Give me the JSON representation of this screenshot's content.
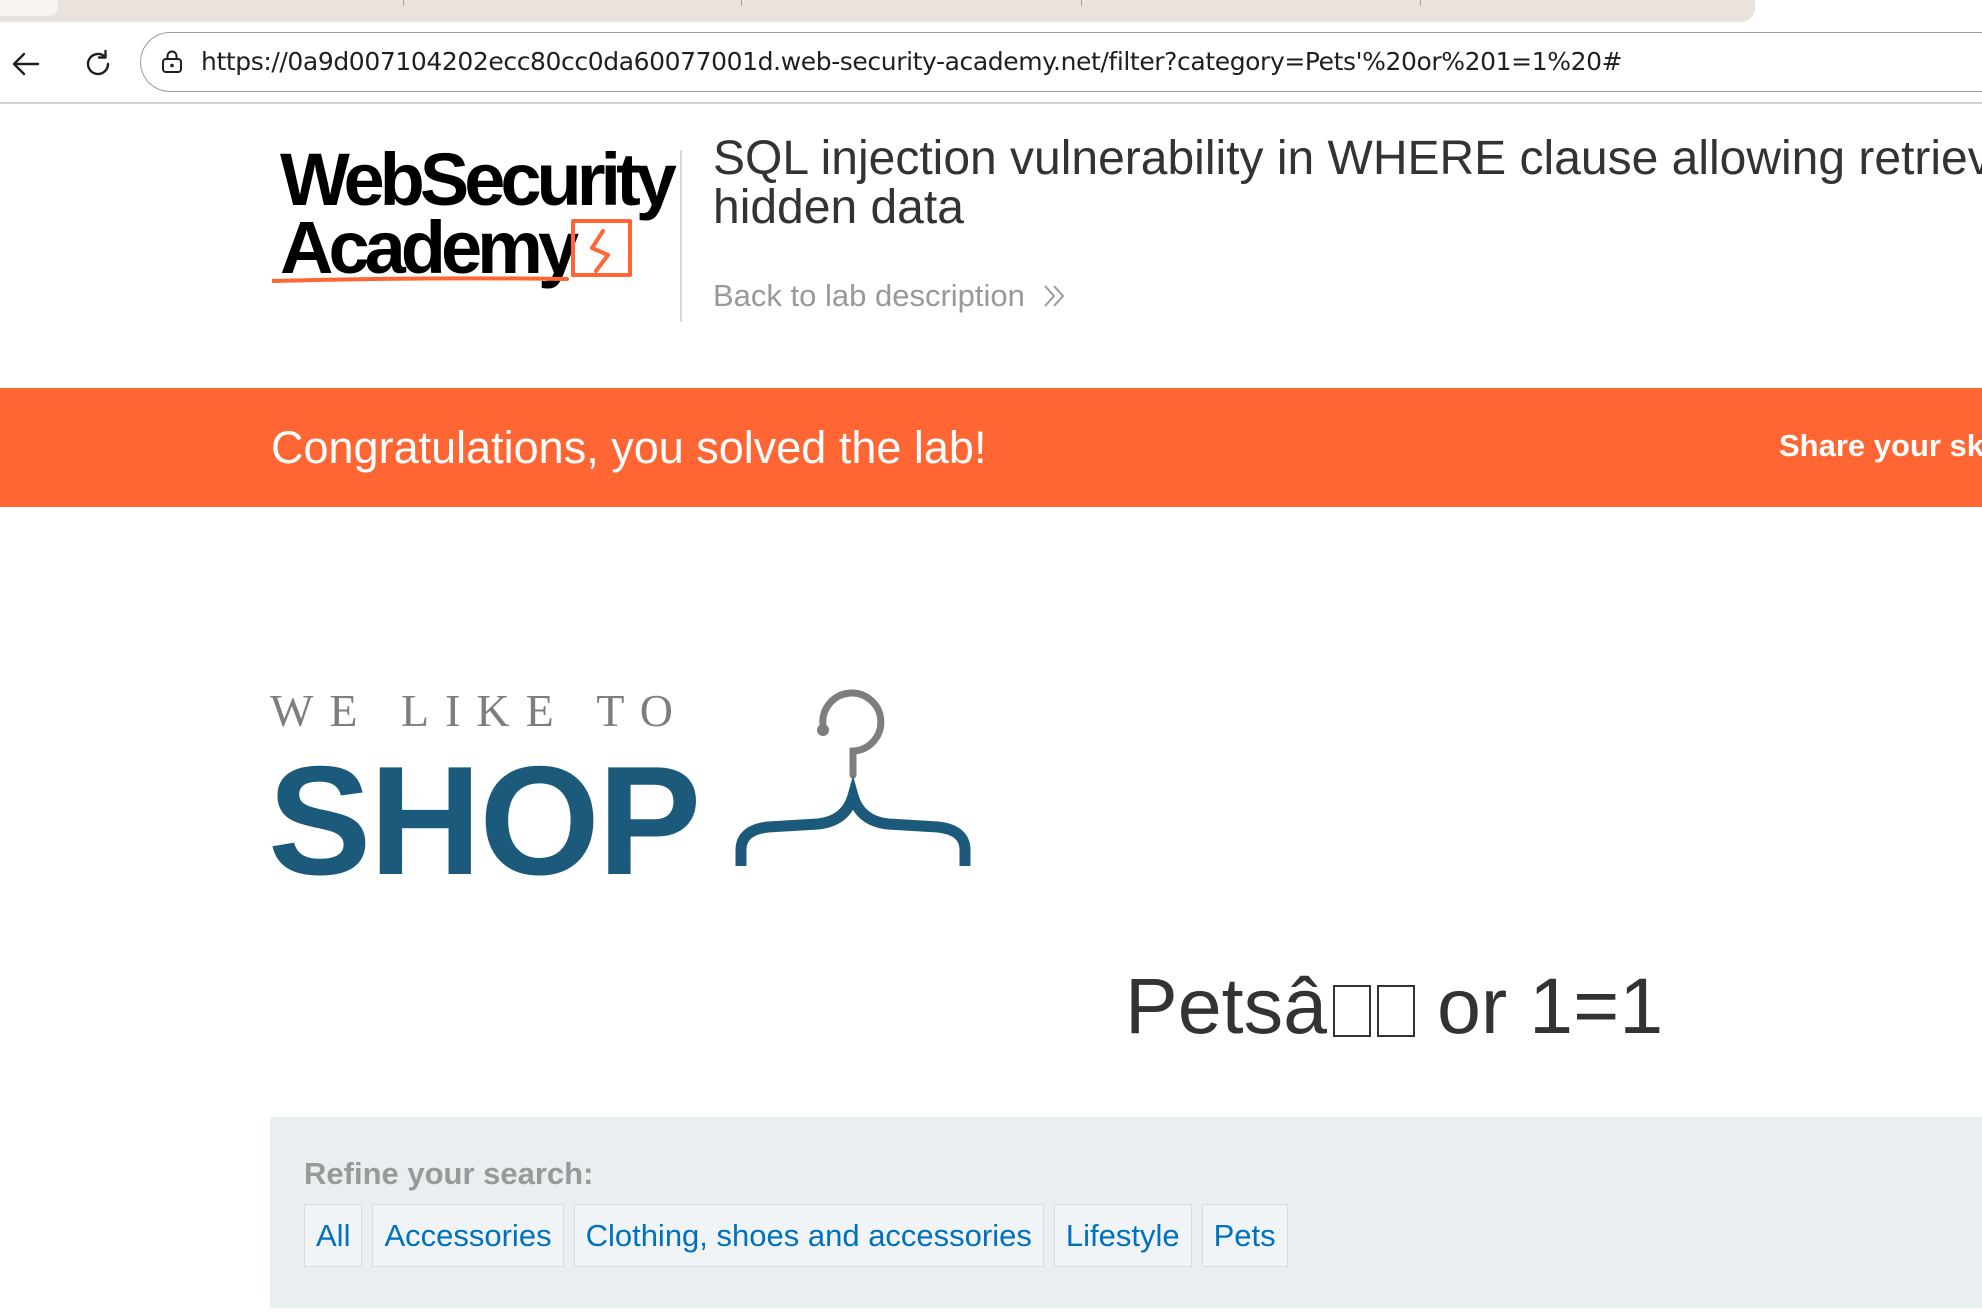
{
  "browser": {
    "url": "https://0a9d007104202ecc80cc0da60077001d.web-security-academy.net/filter?category=Pets'%20or%201=1%20#"
  },
  "lab_header": {
    "logo_line1": "WebSecurity",
    "logo_line2": "Academy",
    "title_line1": "SQL injection vulnerability in WHERE clause allowing retriev",
    "title_line2": "hidden data",
    "back_link": "Back to lab description"
  },
  "banner": {
    "message": "Congratulations, you solved the lab!",
    "share": "Share your sk",
    "color": "#ff6633"
  },
  "shop": {
    "tagline": "WE LIKE TO",
    "word": "SHOP",
    "color": "#1c5a7b"
  },
  "category": {
    "heading_prefix": "Petsâ",
    "heading_suffix": "or 1=1"
  },
  "filter": {
    "label": "Refine your search:",
    "links": [
      "All",
      "Accessories",
      "Clothing, shoes and accessories",
      "Lifestyle",
      "Pets"
    ],
    "link_color": "#0071bc"
  },
  "icons": [
    "back-arrow-icon",
    "reload-icon",
    "site-info-lock-icon",
    "double-chevron-right-icon",
    "hanger-icon"
  ]
}
